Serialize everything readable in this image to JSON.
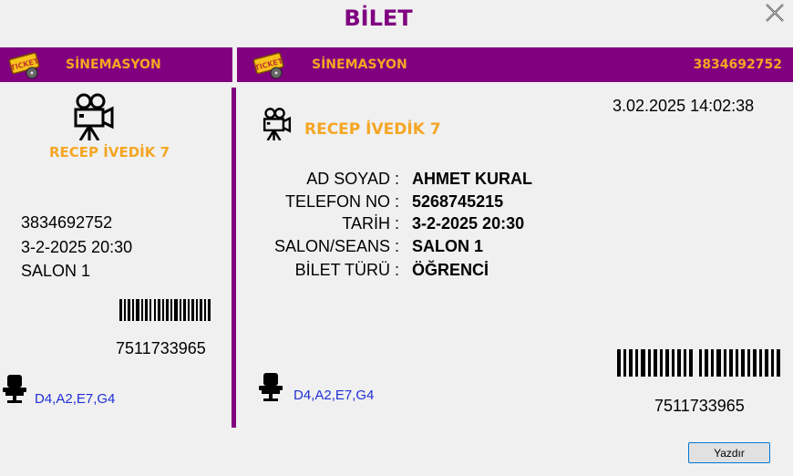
{
  "window": {
    "title": "BİLET"
  },
  "left_stub": {
    "brand": "SİNEMASYON",
    "movie": "RECEP İVEDİK 7",
    "ticket_no": "3834692752",
    "datetime": "3-2-2025 20:30",
    "salon": "SALON 1",
    "barcode_number": "7511733965",
    "seats": "D4,A2,E7,G4"
  },
  "right_ticket": {
    "brand": "SİNEMASYON",
    "ticket_no": "3834692752",
    "printed_at": "3.02.2025 14:02:38",
    "movie": "RECEP İVEDİK 7",
    "fields": [
      {
        "label": "AD SOYAD :",
        "value": "AHMET KURAL"
      },
      {
        "label": "TELEFON NO :",
        "value": "5268745215"
      },
      {
        "label": "TARİH :",
        "value": "3-2-2025 20:30"
      },
      {
        "label": "SALON/SEANS :",
        "value": "SALON 1"
      },
      {
        "label": "BİLET TÜRÜ :",
        "value": "ÖĞRENCİ"
      }
    ],
    "barcode_number": "7511733965",
    "seats": "D4,A2,E7,G4"
  },
  "actions": {
    "print_label": "Yazdır"
  },
  "colors": {
    "brand_purple": "#800080",
    "brand_orange": "#f5a623",
    "seat_blue": "#1f2fd6"
  },
  "icons": [
    "close-icon",
    "ticket-icon",
    "movie-camera-icon",
    "seat-icon",
    "barcode"
  ]
}
